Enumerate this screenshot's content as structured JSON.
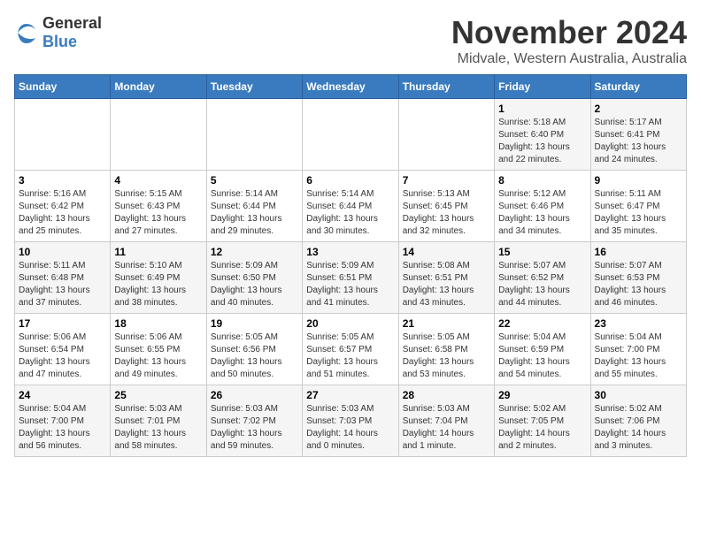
{
  "logo": {
    "text_general": "General",
    "text_blue": "Blue"
  },
  "title": {
    "month": "November 2024",
    "location": "Midvale, Western Australia, Australia"
  },
  "headers": [
    "Sunday",
    "Monday",
    "Tuesday",
    "Wednesday",
    "Thursday",
    "Friday",
    "Saturday"
  ],
  "weeks": [
    [
      {
        "day": "",
        "sunrise": "",
        "sunset": "",
        "daylight": ""
      },
      {
        "day": "",
        "sunrise": "",
        "sunset": "",
        "daylight": ""
      },
      {
        "day": "",
        "sunrise": "",
        "sunset": "",
        "daylight": ""
      },
      {
        "day": "",
        "sunrise": "",
        "sunset": "",
        "daylight": ""
      },
      {
        "day": "",
        "sunrise": "",
        "sunset": "",
        "daylight": ""
      },
      {
        "day": "1",
        "sunrise": "Sunrise: 5:18 AM",
        "sunset": "Sunset: 6:40 PM",
        "daylight": "Daylight: 13 hours and 22 minutes."
      },
      {
        "day": "2",
        "sunrise": "Sunrise: 5:17 AM",
        "sunset": "Sunset: 6:41 PM",
        "daylight": "Daylight: 13 hours and 24 minutes."
      }
    ],
    [
      {
        "day": "3",
        "sunrise": "Sunrise: 5:16 AM",
        "sunset": "Sunset: 6:42 PM",
        "daylight": "Daylight: 13 hours and 25 minutes."
      },
      {
        "day": "4",
        "sunrise": "Sunrise: 5:15 AM",
        "sunset": "Sunset: 6:43 PM",
        "daylight": "Daylight: 13 hours and 27 minutes."
      },
      {
        "day": "5",
        "sunrise": "Sunrise: 5:14 AM",
        "sunset": "Sunset: 6:44 PM",
        "daylight": "Daylight: 13 hours and 29 minutes."
      },
      {
        "day": "6",
        "sunrise": "Sunrise: 5:14 AM",
        "sunset": "Sunset: 6:44 PM",
        "daylight": "Daylight: 13 hours and 30 minutes."
      },
      {
        "day": "7",
        "sunrise": "Sunrise: 5:13 AM",
        "sunset": "Sunset: 6:45 PM",
        "daylight": "Daylight: 13 hours and 32 minutes."
      },
      {
        "day": "8",
        "sunrise": "Sunrise: 5:12 AM",
        "sunset": "Sunset: 6:46 PM",
        "daylight": "Daylight: 13 hours and 34 minutes."
      },
      {
        "day": "9",
        "sunrise": "Sunrise: 5:11 AM",
        "sunset": "Sunset: 6:47 PM",
        "daylight": "Daylight: 13 hours and 35 minutes."
      }
    ],
    [
      {
        "day": "10",
        "sunrise": "Sunrise: 5:11 AM",
        "sunset": "Sunset: 6:48 PM",
        "daylight": "Daylight: 13 hours and 37 minutes."
      },
      {
        "day": "11",
        "sunrise": "Sunrise: 5:10 AM",
        "sunset": "Sunset: 6:49 PM",
        "daylight": "Daylight: 13 hours and 38 minutes."
      },
      {
        "day": "12",
        "sunrise": "Sunrise: 5:09 AM",
        "sunset": "Sunset: 6:50 PM",
        "daylight": "Daylight: 13 hours and 40 minutes."
      },
      {
        "day": "13",
        "sunrise": "Sunrise: 5:09 AM",
        "sunset": "Sunset: 6:51 PM",
        "daylight": "Daylight: 13 hours and 41 minutes."
      },
      {
        "day": "14",
        "sunrise": "Sunrise: 5:08 AM",
        "sunset": "Sunset: 6:51 PM",
        "daylight": "Daylight: 13 hours and 43 minutes."
      },
      {
        "day": "15",
        "sunrise": "Sunrise: 5:07 AM",
        "sunset": "Sunset: 6:52 PM",
        "daylight": "Daylight: 13 hours and 44 minutes."
      },
      {
        "day": "16",
        "sunrise": "Sunrise: 5:07 AM",
        "sunset": "Sunset: 6:53 PM",
        "daylight": "Daylight: 13 hours and 46 minutes."
      }
    ],
    [
      {
        "day": "17",
        "sunrise": "Sunrise: 5:06 AM",
        "sunset": "Sunset: 6:54 PM",
        "daylight": "Daylight: 13 hours and 47 minutes."
      },
      {
        "day": "18",
        "sunrise": "Sunrise: 5:06 AM",
        "sunset": "Sunset: 6:55 PM",
        "daylight": "Daylight: 13 hours and 49 minutes."
      },
      {
        "day": "19",
        "sunrise": "Sunrise: 5:05 AM",
        "sunset": "Sunset: 6:56 PM",
        "daylight": "Daylight: 13 hours and 50 minutes."
      },
      {
        "day": "20",
        "sunrise": "Sunrise: 5:05 AM",
        "sunset": "Sunset: 6:57 PM",
        "daylight": "Daylight: 13 hours and 51 minutes."
      },
      {
        "day": "21",
        "sunrise": "Sunrise: 5:05 AM",
        "sunset": "Sunset: 6:58 PM",
        "daylight": "Daylight: 13 hours and 53 minutes."
      },
      {
        "day": "22",
        "sunrise": "Sunrise: 5:04 AM",
        "sunset": "Sunset: 6:59 PM",
        "daylight": "Daylight: 13 hours and 54 minutes."
      },
      {
        "day": "23",
        "sunrise": "Sunrise: 5:04 AM",
        "sunset": "Sunset: 7:00 PM",
        "daylight": "Daylight: 13 hours and 55 minutes."
      }
    ],
    [
      {
        "day": "24",
        "sunrise": "Sunrise: 5:04 AM",
        "sunset": "Sunset: 7:00 PM",
        "daylight": "Daylight: 13 hours and 56 minutes."
      },
      {
        "day": "25",
        "sunrise": "Sunrise: 5:03 AM",
        "sunset": "Sunset: 7:01 PM",
        "daylight": "Daylight: 13 hours and 58 minutes."
      },
      {
        "day": "26",
        "sunrise": "Sunrise: 5:03 AM",
        "sunset": "Sunset: 7:02 PM",
        "daylight": "Daylight: 13 hours and 59 minutes."
      },
      {
        "day": "27",
        "sunrise": "Sunrise: 5:03 AM",
        "sunset": "Sunset: 7:03 PM",
        "daylight": "Daylight: 14 hours and 0 minutes."
      },
      {
        "day": "28",
        "sunrise": "Sunrise: 5:03 AM",
        "sunset": "Sunset: 7:04 PM",
        "daylight": "Daylight: 14 hours and 1 minute."
      },
      {
        "day": "29",
        "sunrise": "Sunrise: 5:02 AM",
        "sunset": "Sunset: 7:05 PM",
        "daylight": "Daylight: 14 hours and 2 minutes."
      },
      {
        "day": "30",
        "sunrise": "Sunrise: 5:02 AM",
        "sunset": "Sunset: 7:06 PM",
        "daylight": "Daylight: 14 hours and 3 minutes."
      }
    ]
  ]
}
